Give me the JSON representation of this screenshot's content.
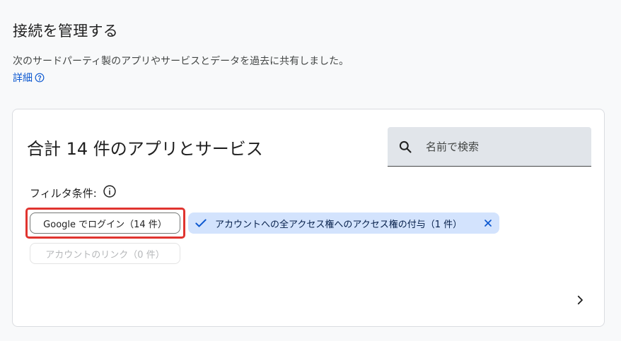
{
  "page": {
    "title": "接続を管理する",
    "description": "次のサードパーティ製のアプリやサービスとデータを過去に共有しました。",
    "details_link": "詳細"
  },
  "card": {
    "title": "合計 14 件のアプリとサービス",
    "search_placeholder": "名前で検索",
    "filter_label": "フィルタ条件:",
    "chips": {
      "google_signin": "Google でログイン（14 件）",
      "account_access": "アカウントへの全アクセス権へのアクセス権の付与（1 件）",
      "account_link": "アカウントのリンク（0 件）"
    }
  },
  "icons": {
    "help": "help-circle-icon",
    "search": "search-icon",
    "info": "info-icon",
    "check": "check-icon",
    "close": "close-icon",
    "next": "chevron-right-icon"
  },
  "colors": {
    "link": "#0b57d0",
    "selected_chip": "#d3e3fd",
    "highlight": "#e0342f"
  }
}
